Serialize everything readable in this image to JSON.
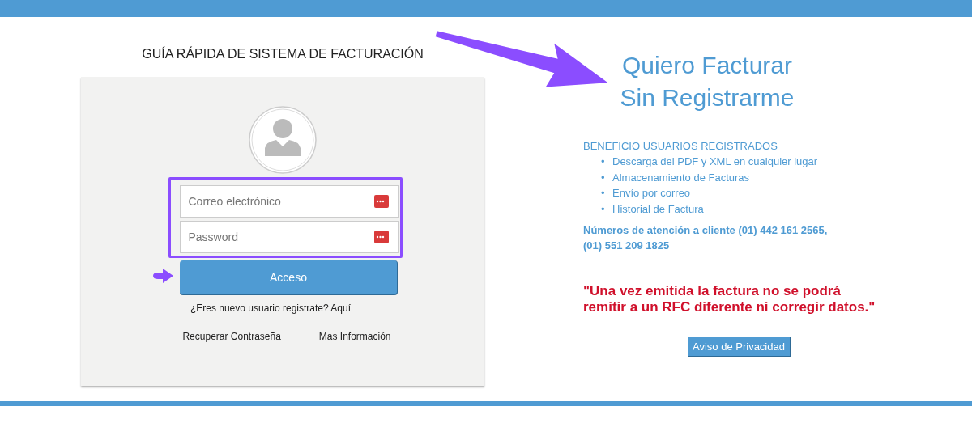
{
  "guide_title": "GUÍA RÁPIDA DE SISTEMA DE FACTURACIÓN",
  "login": {
    "fields": [
      {
        "placeholder": "Correo electrónico"
      },
      {
        "placeholder": "Password"
      }
    ],
    "submit": "Acceso",
    "register_link": "¿Eres nuevo usuario registrate? Aquí",
    "links": [
      "Recuperar Contraseña",
      "Mas Información"
    ]
  },
  "cta": [
    "Quiero Facturar",
    "Sin Registrarme"
  ],
  "benefits": {
    "title": "BENEFICIO USUARIOS REGISTRADOS",
    "items": [
      {
        "bullet": "•",
        "text": "Descarga del PDF y XML en cualquier lugar"
      },
      {
        "bullet": "•",
        "text": "Almacenamiento de Facturas"
      },
      {
        "bullet": "•",
        "text": "Envío por correo"
      },
      {
        "bullet": "•",
        "text": "Historial de Factura"
      }
    ]
  },
  "contact": [
    "Números de atención a cliente (01) 442 161 2565,",
    "(01) 551 209 1825"
  ],
  "warning": [
    "\"Una vez emitida la factura no se podrá",
    "remitir a un RFC diferente ni corregir datos.\""
  ],
  "privacy_button": "Aviso de Privacidad"
}
